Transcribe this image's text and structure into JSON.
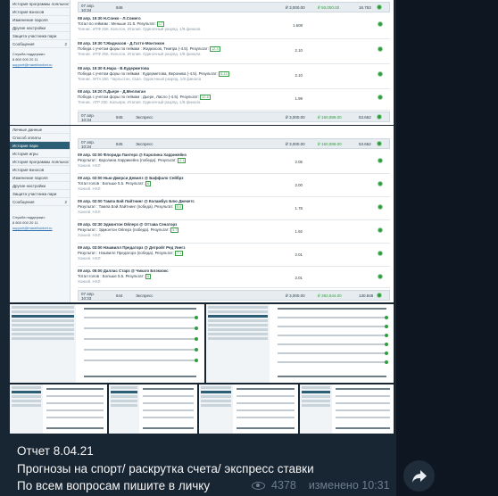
{
  "photo1": {
    "sidebar": [
      {
        "label": "История программы лояльности",
        "active": false
      },
      {
        "label": "История взносов",
        "active": false
      },
      {
        "label": "Изменение пароля",
        "active": false
      },
      {
        "label": "Другие настройки",
        "active": false
      },
      {
        "label": "Защита участника пари",
        "active": false
      },
      {
        "label": "Сообщения",
        "active": false,
        "badge": "2"
      }
    ],
    "support": "Служба поддержки:\n8 800 000 20 11",
    "support_email": "support@marathonbet.ru",
    "top_row": {
      "date": "07 апр.\n10:34",
      "id": "846",
      "amount": "₽ 3,000.00",
      "payout": "₽ 50,000.00",
      "num": "16.753"
    },
    "bets": [
      {
        "head": "08 апр. 19:30  Н.Сонко - Л.Сомего",
        "line": "Тотал по геймам : Меньше 21.5. Результат:",
        "tag": "17",
        "note": "Теннис. ИТФ 25К. Кельтон, Италия. Одиночный разряд. 1/8 финала",
        "coef": "1.608"
      },
      {
        "head": "08 апр. 19:30  Т.Жидеасов - Д.Гатто-Монтикон",
        "line": "Победа с учетом форы по геймам : Жидеасов, Темпра (-4.5). Результат:",
        "tag": "12-3",
        "note": "Теннис. ИТФ 25К. Кельтон, Италия. Одиночный разряд. 1/8 финала",
        "coef": "2.10"
      },
      {
        "head": "08 апр. 19:30  К.Нара - В.Кудерметова",
        "line": "Победа с учетом форы по геймам : Кудерметова, Вероника (-4.5). Результат:",
        "tag": "5-13",
        "note": "Теннис. WTA 250. Чарльстон, США. Одиночный разряд. 1/8 финала",
        "coef": "2.10"
      },
      {
        "head": "08 апр. 19:20  Л.Дьере - Д.Меллиган",
        "line": "Победа с учетом форы по геймам : Дьере, Ласло (-4.5). Результат:",
        "tag": "12-6",
        "note": "Теннис. ATP 250. Кальяри, Италия. Одиночный разряд. 1/8 финала",
        "coef": "1.99"
      }
    ],
    "bottom_row": {
      "date": "07 апр.\n10:34",
      "id": "845",
      "type": "Экспресс",
      "amount": "₽ 3,000.00",
      "payout": "₽ 160,988.00",
      "num": "53.662"
    }
  },
  "photo2": {
    "sidebar": [
      {
        "label": "Личные данные",
        "active": false
      },
      {
        "label": "Способ оплаты",
        "active": false
      },
      {
        "label": "История пари",
        "active": true
      },
      {
        "label": "История игры",
        "active": false
      },
      {
        "label": "История программы лояльности",
        "active": false
      },
      {
        "label": "История взносов",
        "active": false
      },
      {
        "label": "Изменение пароля",
        "active": false
      },
      {
        "label": "Другие настройки",
        "active": false
      },
      {
        "label": "Защита участника пари",
        "active": false
      },
      {
        "label": "Сообщения",
        "active": false,
        "badge": "2"
      }
    ],
    "support": "Служба поддержки:\n8 800 000 20 11",
    "support_email": "support@marathonbet.ru",
    "top_row": {
      "date": "07 апр.\n10:34",
      "id": "845",
      "type": "Экспресс",
      "amount": "₽ 3,000.00",
      "payout": "₽ 160,988.00",
      "num": "53.662"
    },
    "bets": [
      {
        "head": "09 апр. 02:00  Флорида Пантерз @ Каролина Харрикейнз",
        "line": "Результат : Каролина Харрикейнз (победа). Результат:",
        "tag": "2:1",
        "note": "Хоккей. НХЛ",
        "coef": "2.05"
      },
      {
        "head": "09 апр. 02:00  Нью-Джерси Девилз @ Баффало Сейбрз",
        "line": "Тотал голов : Больше 5.5. Результат:",
        "tag": "6",
        "note": "Хоккей. НХЛ",
        "coef": "2.00"
      },
      {
        "head": "09 апр. 02:00  Тампа Бэй Лайтнинг @ Коламбус Блю Джекетс",
        "line": "Результат : Тампа Бэй Лайтнинг (победа). Результат:",
        "tag": "5:4",
        "note": "Хоккей. НХЛ",
        "coef": "1.78"
      },
      {
        "head": "09 апр. 02:30  Эдмонтон Ойлерз @ Оттава Сенаторз",
        "line": "Результат : Эдмонтон Ойлерз (победа). Результат:",
        "tag": "3:7",
        "note": "Хоккей. НХЛ",
        "coef": "1.92"
      },
      {
        "head": "09 апр. 03:00  Нэшвилл Предаторз @ Детройт Ред Уингз",
        "line": "Результат : Нэшвилл Предаторз (победа). Результат:",
        "tag": "7:1",
        "note": "Хоккей. НХЛ",
        "coef": "2.01"
      },
      {
        "head": "09 апр. 05:00  Даллас Старз @ Чикаго Блэкхокс",
        "line": "Тотал голов : Больше 5.5. Результат:",
        "tag": "6",
        "note": "Хоккей. НХЛ",
        "coef": "2.01"
      }
    ],
    "bottom_row": {
      "date": "07 апр.\n10:33",
      "id": "844",
      "type": "Экспресс",
      "amount": "₽ 3,000.00",
      "payout": "₽ 392,544.00",
      "num": "130.848"
    }
  },
  "caption": {
    "line1": "Отчет 8.04.21",
    "line2": "Прогнозы на спорт/ раскрутка счета/ экспресс ставки",
    "line3": "По всем вопросам пишите в личку"
  },
  "meta": {
    "views": "4378",
    "edited": "изменено 10:31"
  },
  "icons": {
    "views": "eye-icon",
    "share": "share-arrow-icon",
    "status": "check-circle-icon"
  },
  "colors": {
    "chat_bg": "#0e1621",
    "bubble_bg": "#182533",
    "accent": "#2c5f76",
    "win": "#2e9d3c"
  }
}
